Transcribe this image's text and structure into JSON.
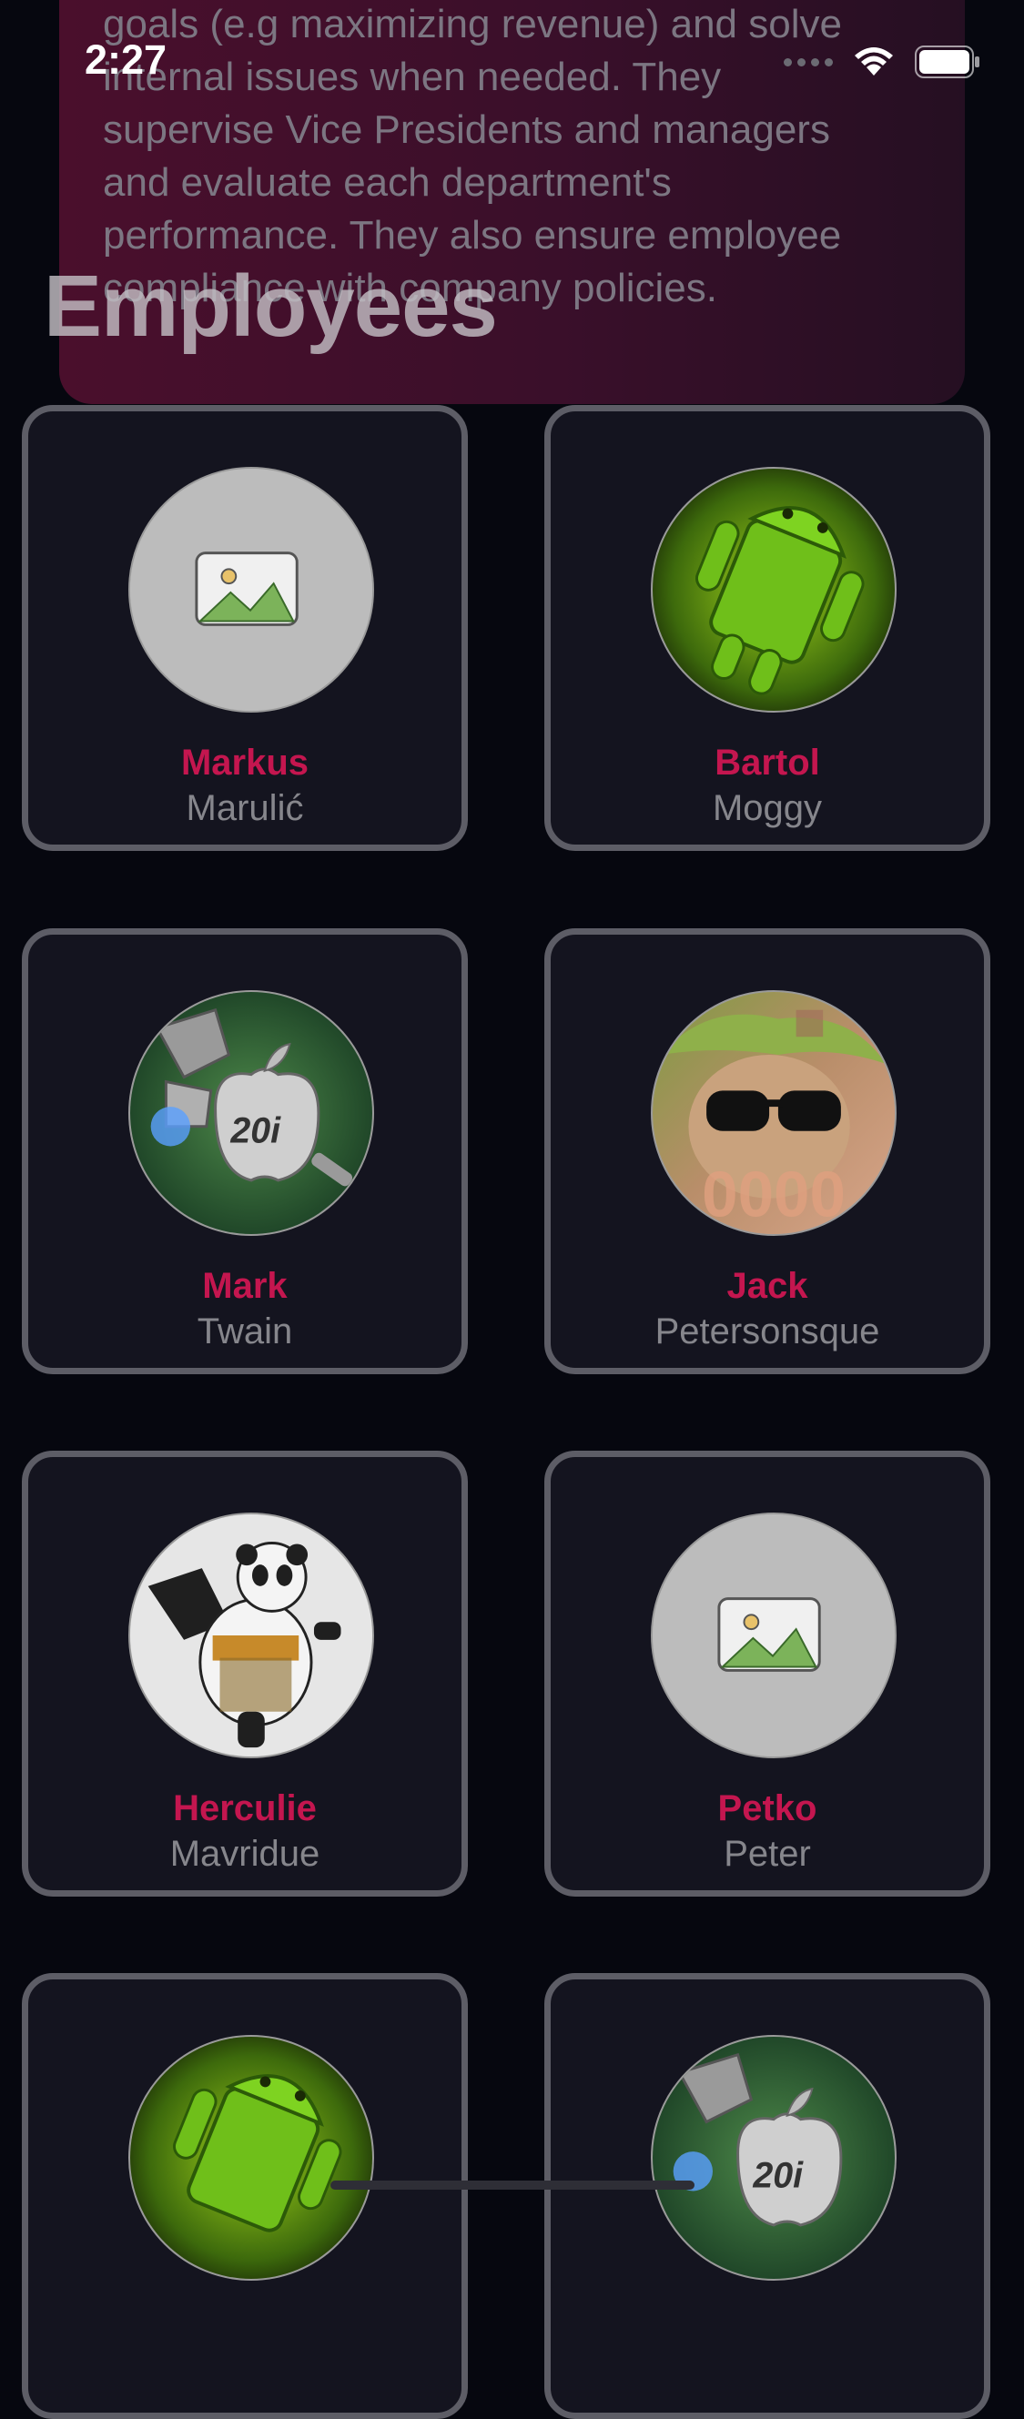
{
  "status_bar": {
    "time": "2:27"
  },
  "role": {
    "lines": [
      "goals (e.g maximizing revenue) and solve",
      "internal issues when needed. They",
      "supervise Vice Presidents and managers",
      "and evaluate each department's",
      "performance. They also ensure employee",
      "compliance with company policies."
    ]
  },
  "page": {
    "title": "Employees"
  },
  "employees": [
    {
      "first_name": "Markus",
      "last_name": "Marulić",
      "avatar": "placeholder-image-icon"
    },
    {
      "first_name": "Bartol",
      "last_name": "Moggy",
      "avatar": "android-robot-image"
    },
    {
      "first_name": "Mark",
      "last_name": "Twain",
      "avatar": "robot-apple-image"
    },
    {
      "first_name": "Jack",
      "last_name": "Petersonsque",
      "avatar": "hamster-sunglasses-image"
    },
    {
      "first_name": "Herculie",
      "last_name": "Mavridue",
      "avatar": "kung-fu-panda-image"
    },
    {
      "first_name": "Petko",
      "last_name": "Peter",
      "avatar": "placeholder-image-icon"
    },
    {
      "first_name": "",
      "last_name": "",
      "avatar": "android-robot-image"
    },
    {
      "first_name": "",
      "last_name": "",
      "avatar": "robot-apple-image"
    }
  ],
  "colors": {
    "background": "#06070f",
    "card_background": "#14141f",
    "card_border": "#5d5d66",
    "accent_first_name": "#c4164f",
    "last_name": "#86868c",
    "description_card": "#4a0f2c"
  }
}
